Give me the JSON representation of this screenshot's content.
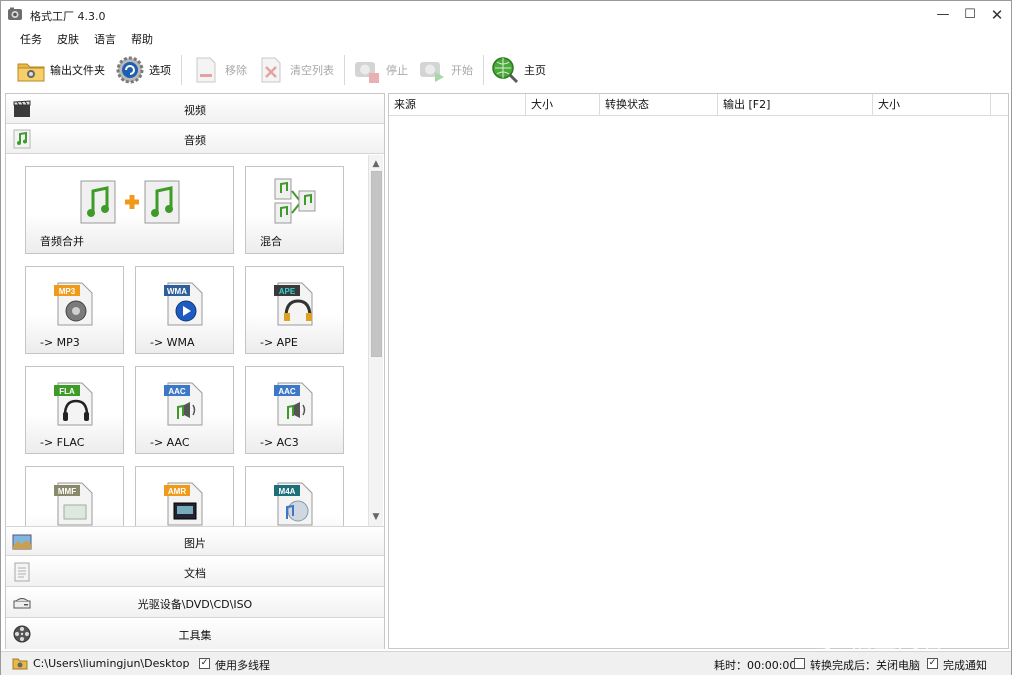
{
  "window": {
    "title": "格式工厂 4.3.0",
    "minimize_glyph": "—",
    "maximize_glyph": "☐",
    "close_glyph": "✕"
  },
  "menu": [
    "任务",
    "皮肤",
    "语言",
    "帮助"
  ],
  "toolbar": {
    "output_folder": "输出文件夹",
    "options": "选项",
    "remove": "移除",
    "clear_list": "清空列表",
    "stop": "停止",
    "start": "开始",
    "home": "主页"
  },
  "categories": {
    "video": "视频",
    "audio": "音频",
    "picture": "图片",
    "document": "文档",
    "rom": "光驱设备\\DVD\\CD\\ISO",
    "tools": "工具集"
  },
  "tiles": [
    {
      "label": "音频合并",
      "badge": ""
    },
    {
      "label": "混合",
      "badge": ""
    },
    {
      "label": "-> MP3",
      "badge": "MP3"
    },
    {
      "label": "-> WMA",
      "badge": "WMA"
    },
    {
      "label": "-> APE",
      "badge": "APE"
    },
    {
      "label": "-> FLAC",
      "badge": "FLA"
    },
    {
      "label": "-> AAC",
      "badge": "AAC"
    },
    {
      "label": "-> AC3",
      "badge": "AAC"
    },
    {
      "label": "",
      "badge": "MMF"
    },
    {
      "label": "",
      "badge": "AMR"
    },
    {
      "label": "",
      "badge": "M4A"
    }
  ],
  "list_columns": [
    "来源",
    "大小",
    "转换状态",
    "输出 [F2]",
    "大小"
  ],
  "statusbar": {
    "path": "C:\\Users\\liumingjun\\Desktop",
    "multithread": "使用多线程",
    "elapsed": "耗时：00:00:00",
    "after_convert": "转换完成后：关闭电脑",
    "notify": "完成通知",
    "check": "✓"
  },
  "watermark": "悟空问答",
  "colors": {
    "accent_green": "#3e9b2a",
    "badge_orange": "#f09a1a",
    "badge_blue": "#2f5f9a",
    "badge_teal": "#1f6f7a",
    "badge_gray": "#8a8a8a"
  }
}
